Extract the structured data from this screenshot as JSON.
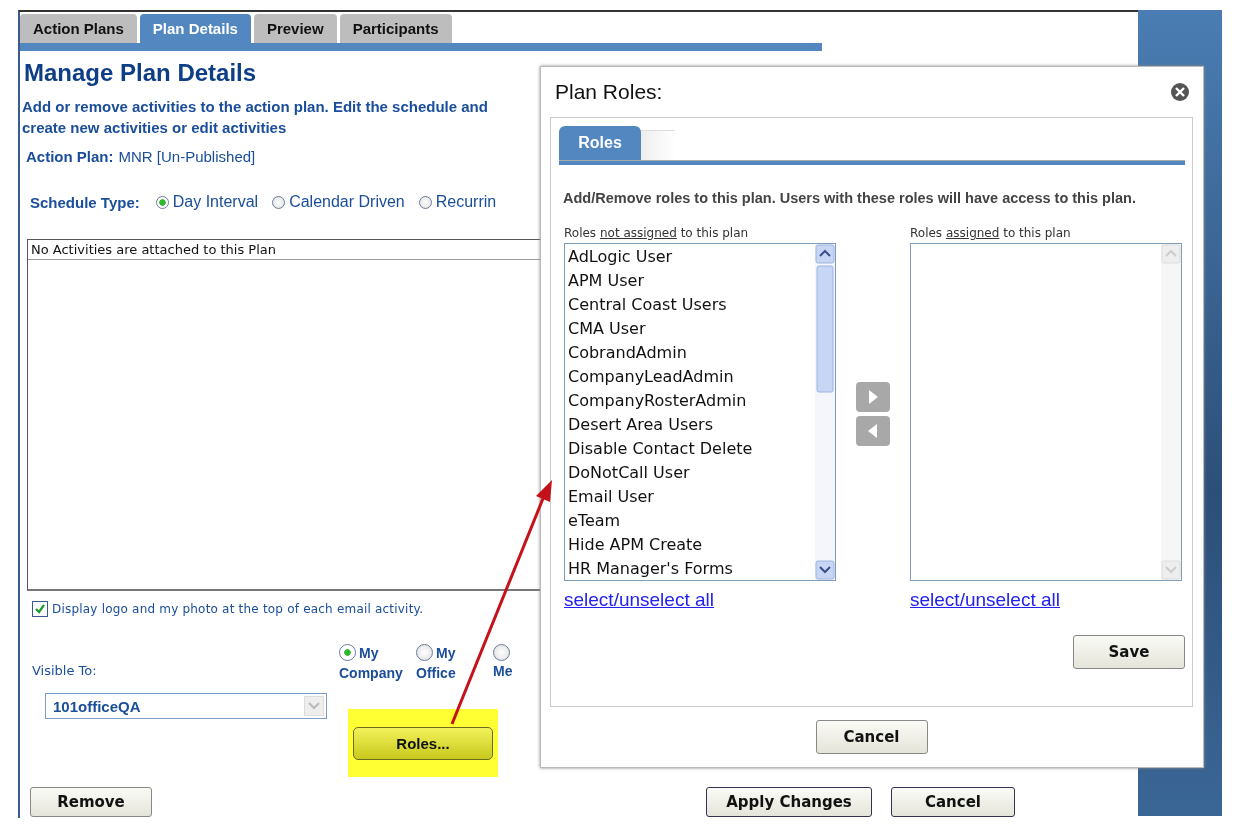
{
  "tabs": [
    {
      "label": "Action Plans",
      "selected": false
    },
    {
      "label": "Plan Details",
      "selected": true
    },
    {
      "label": "Preview",
      "selected": false
    },
    {
      "label": "Participants",
      "selected": false
    }
  ],
  "page": {
    "title": "Manage Plan Details",
    "description": "Add or remove activities to the action plan. Edit the schedule and create new activities or edit activities",
    "action_plan": {
      "label": "Action Plan:",
      "value": "MNR [Un-Published]"
    },
    "schedule_type": {
      "label": "Schedule Type:",
      "options": [
        {
          "label": "Day Interval",
          "selected": true
        },
        {
          "label": "Calendar Driven",
          "selected": false
        },
        {
          "label": "Recurrin",
          "selected": false
        }
      ]
    },
    "activities": {
      "message": "No Activities are attached to this Plan"
    },
    "display_logo": {
      "label": "Display logo and my photo at the top of each email activity.",
      "checked": true
    },
    "visible_to": {
      "label": "Visible To:",
      "options": [
        {
          "label": "My Company",
          "selected": true
        },
        {
          "label": "My Office",
          "selected": false
        },
        {
          "label": "Me",
          "selected": false
        }
      ]
    },
    "office_select": {
      "value": "101officeQA"
    },
    "roles_button": "Roles...",
    "remove_button": "Remove",
    "apply_button": "Apply Changes",
    "cancel_button": "Cancel"
  },
  "dialog": {
    "title": "Plan Roles:",
    "tabs": [
      {
        "label": "Roles",
        "selected": true
      }
    ],
    "description": "Add/Remove roles to this plan. Users with these roles will have access to this plan.",
    "available": {
      "label_before": "Roles",
      "label_key": "not assigned",
      "label_after": "to this plan",
      "link": "select/unselect all",
      "items": [
        "AdLogic User",
        "APM User",
        "Central Coast Users",
        "CMA User",
        "CobrandAdmin",
        "CompanyLeadAdmin",
        "CompanyRosterAdmin",
        "Desert Area Users",
        "Disable Contact Delete",
        "DoNotCall User",
        "Email User",
        "eTeam",
        "Hide APM Create",
        "HR Manager's Forms"
      ]
    },
    "assigned": {
      "label_before": "Roles",
      "label_key": "assigned",
      "label_after": "to this plan",
      "link": "select/unselect all"
    },
    "save_button": "Save",
    "cancel_button": "Cancel"
  }
}
